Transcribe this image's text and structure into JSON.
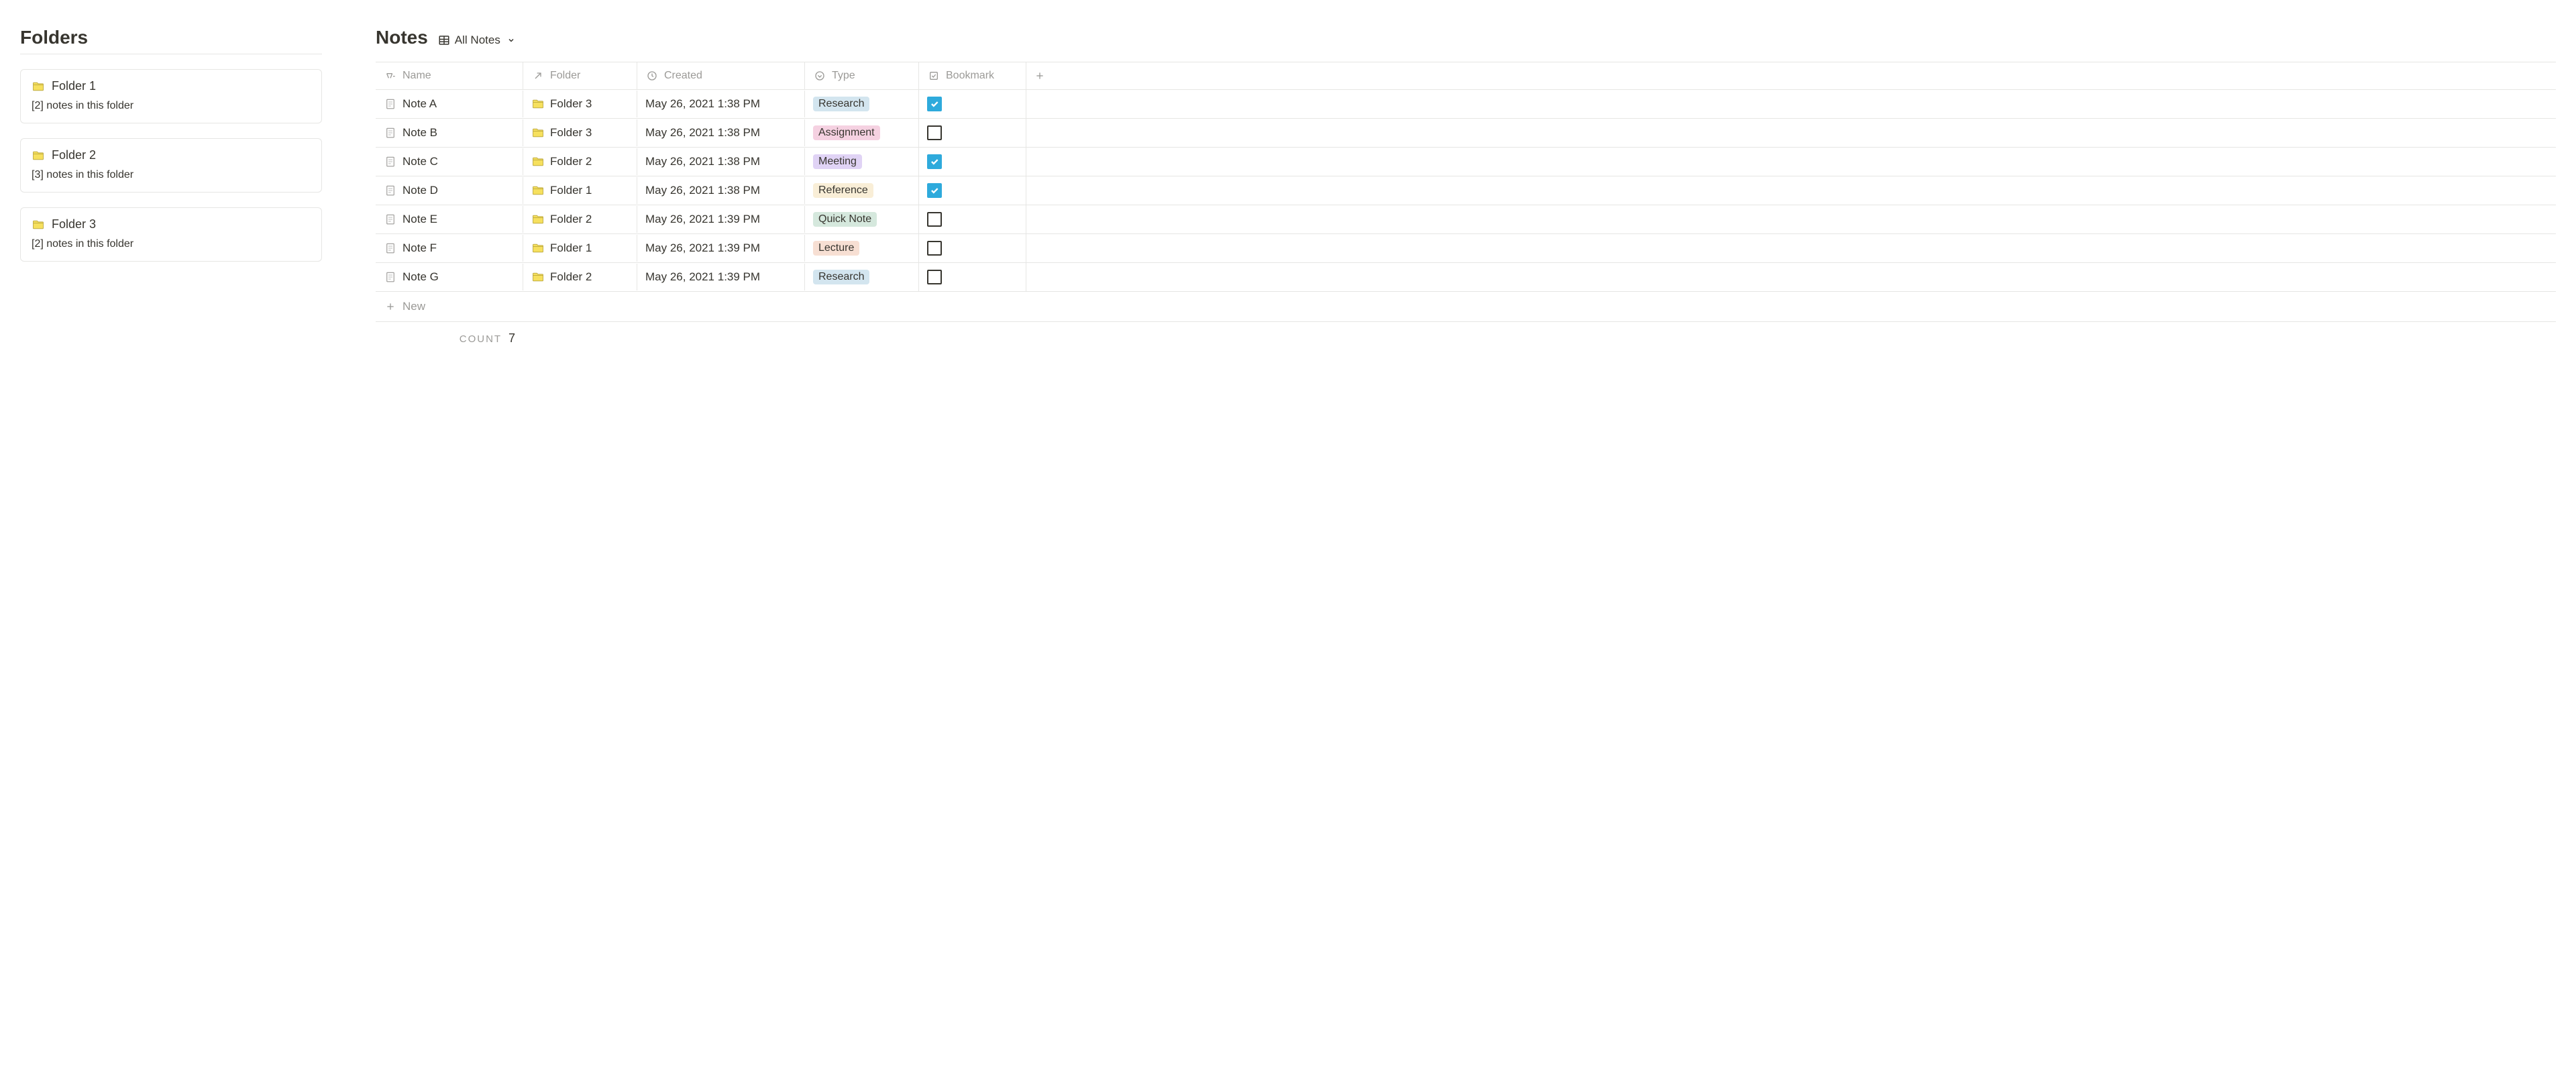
{
  "sidebar": {
    "title": "Folders",
    "folders": [
      {
        "name": "Folder 1",
        "count": 2,
        "sub": "[2] notes in this folder"
      },
      {
        "name": "Folder 2",
        "count": 3,
        "sub": "[3] notes in this folder"
      },
      {
        "name": "Folder 3",
        "count": 2,
        "sub": "[2] notes in this folder"
      }
    ]
  },
  "notes": {
    "title": "Notes",
    "view_label": "All Notes",
    "columns": {
      "name": "Name",
      "folder": "Folder",
      "created": "Created",
      "type": "Type",
      "bookmark": "Bookmark"
    },
    "rows": [
      {
        "name": "Note A",
        "folder": "Folder 3",
        "created": "May 26, 2021 1:38 PM",
        "type": "Research",
        "type_color": "blue",
        "bookmark": true
      },
      {
        "name": "Note B",
        "folder": "Folder 3",
        "created": "May 26, 2021 1:38 PM",
        "type": "Assignment",
        "type_color": "pink",
        "bookmark": false
      },
      {
        "name": "Note C",
        "folder": "Folder 2",
        "created": "May 26, 2021 1:38 PM",
        "type": "Meeting",
        "type_color": "purple",
        "bookmark": true
      },
      {
        "name": "Note D",
        "folder": "Folder 1",
        "created": "May 26, 2021 1:38 PM",
        "type": "Reference",
        "type_color": "yellow",
        "bookmark": true
      },
      {
        "name": "Note E",
        "folder": "Folder 2",
        "created": "May 26, 2021 1:39 PM",
        "type": "Quick Note",
        "type_color": "green",
        "bookmark": false
      },
      {
        "name": "Note F",
        "folder": "Folder 1",
        "created": "May 26, 2021 1:39 PM",
        "type": "Lecture",
        "type_color": "orange",
        "bookmark": false
      },
      {
        "name": "Note G",
        "folder": "Folder 2",
        "created": "May 26, 2021 1:39 PM",
        "type": "Research",
        "type_color": "blue",
        "bookmark": false
      }
    ],
    "new_label": "New",
    "count_label": "COUNT",
    "count_value": "7"
  }
}
